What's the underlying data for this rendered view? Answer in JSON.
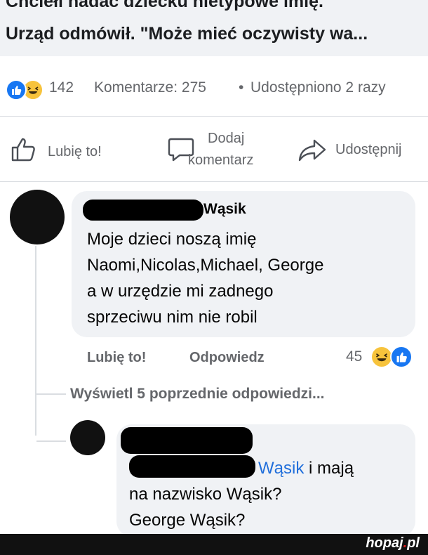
{
  "post": {
    "title_line1": "Chciełi nadać dziecku nietypowe imię.",
    "title_line2": "Urząd odmówił. \"Może mieć oczywisty wa..."
  },
  "stats": {
    "reactions_count": "142",
    "comments": "Komentarze: 275",
    "separator": "•",
    "shares": "Udostępniono 2 razy",
    "reaction_icons": [
      "like-icon",
      "haha-icon"
    ]
  },
  "actions": {
    "like_label": "Lubię to!",
    "comment_label_line1": "Dodaj",
    "comment_label_line2": "komentarz",
    "share_label": "Udostępnij"
  },
  "comment1": {
    "author": "Wąsik",
    "text_lines": [
      "Moje dzieci noszą imię",
      "Naomi,Nicolas,Michael, George",
      "a w urzędzie mi zadnego",
      "sprzeciwu nim nie robil"
    ],
    "like_label": "Lubię to!",
    "reply_label": "Odpowiedz",
    "reactions_count": "45",
    "reaction_icons": [
      "haha-icon",
      "like-icon"
    ]
  },
  "view_previous": "Wyświetl 5 poprzednie odpowiedzi...",
  "reply": {
    "mention": "Wąsik",
    "text_line1_rest": "i mają",
    "text_line2": "na nazwisko Wąsik?",
    "text_line3": "George Wąsik?"
  },
  "watermark": {
    "brand": "hopaj",
    "dot": ".",
    "tld": "pl"
  },
  "colors": {
    "facebook_blue": "#1877f2",
    "mention_blue": "#216fdb",
    "bubble_gray": "#f0f2f5",
    "secondary_text": "#65676b",
    "watermark_red": "#e0201f"
  }
}
